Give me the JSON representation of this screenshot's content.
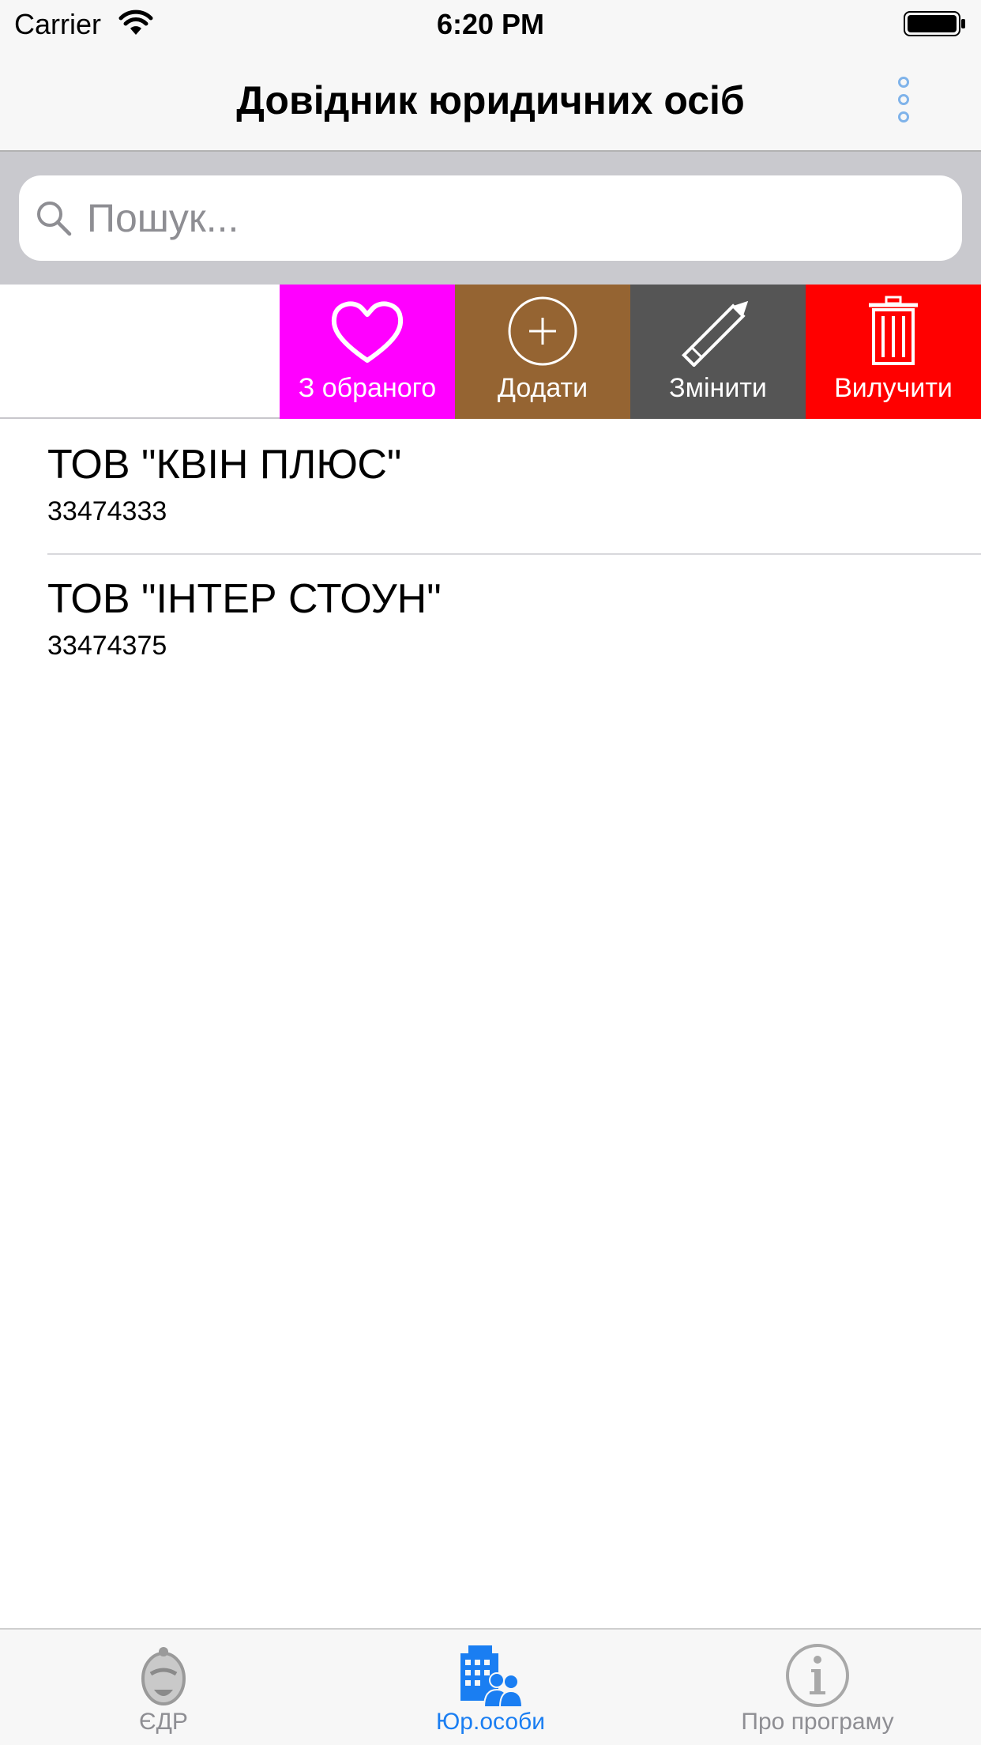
{
  "status_bar": {
    "carrier": "Carrier",
    "time": "6:20 PM"
  },
  "nav": {
    "title": "Довідник юридичних осіб",
    "more_icon": "vertical-dots-icon"
  },
  "search": {
    "placeholder": "Пошук...",
    "value": ""
  },
  "swipe_actions": [
    {
      "label": "З обраного",
      "icon": "heart-icon",
      "color": "#ff00ff"
    },
    {
      "label": "Додати",
      "icon": "plus-circle-icon",
      "color": "#956432"
    },
    {
      "label": "Змінити",
      "icon": "pencil-icon",
      "color": "#555555"
    },
    {
      "label": "Вилучити",
      "icon": "trash-icon",
      "color": "#ff0000"
    }
  ],
  "list": [
    {
      "title": "ТОВ \"КВІН ПЛЮС\"",
      "code": "33474333"
    },
    {
      "title": "ТОВ \"ІНТЕР СТОУН\"",
      "code": "33474375"
    }
  ],
  "tabs": [
    {
      "label": "ЄДР",
      "icon": "edr-emblem-icon",
      "active": false
    },
    {
      "label": "Юр.особи",
      "icon": "buildings-people-icon",
      "active": true
    },
    {
      "label": "Про програму",
      "icon": "info-icon",
      "active": false
    }
  ],
  "colors": {
    "accent": "#1a7ef2",
    "inactive": "#8e8e93"
  }
}
